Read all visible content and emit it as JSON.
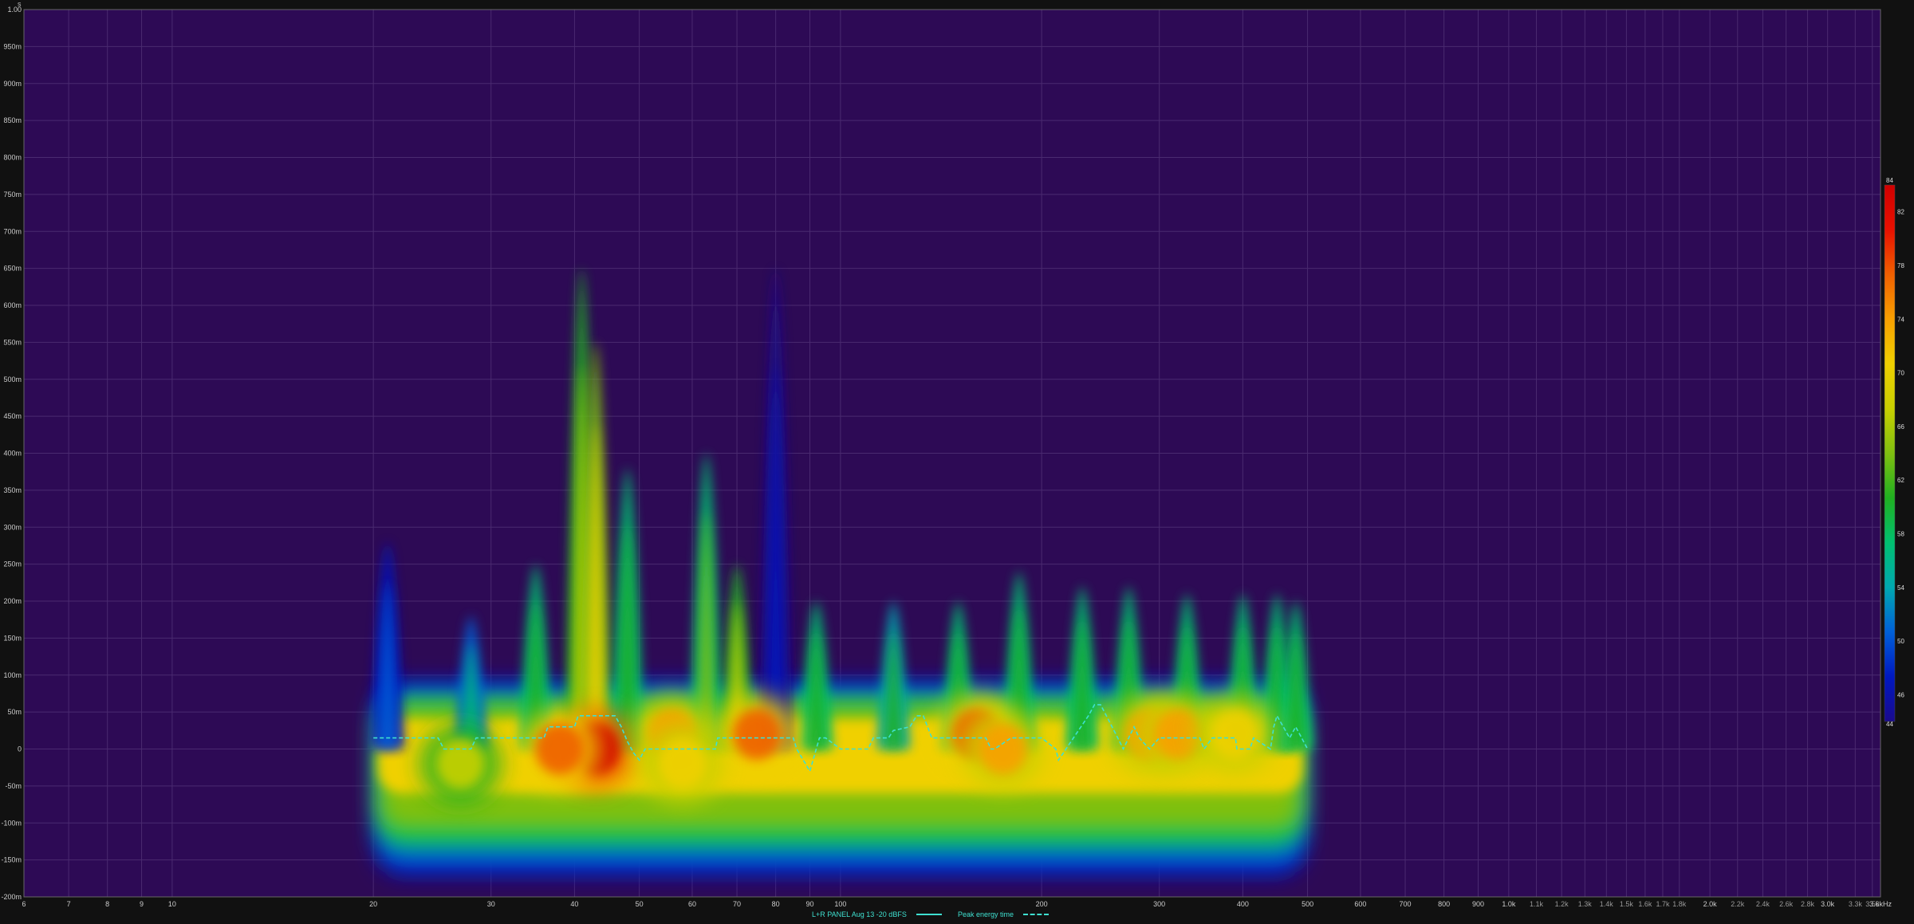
{
  "chart_data": {
    "type": "heatmap",
    "title": "",
    "top_label": "s",
    "xlabel": "",
    "ylabel": "",
    "x_scale": "log",
    "xlim": [
      6,
      3600
    ],
    "ylim": [
      -0.2,
      1.0
    ],
    "x_ticks": [
      {
        "v": 6,
        "t": "6"
      },
      {
        "v": 7,
        "t": "7"
      },
      {
        "v": 8,
        "t": "8"
      },
      {
        "v": 9,
        "t": "9"
      },
      {
        "v": 10,
        "t": "10"
      },
      {
        "v": 20,
        "t": "20"
      },
      {
        "v": 30,
        "t": "30"
      },
      {
        "v": 40,
        "t": "40"
      },
      {
        "v": 50,
        "t": "50"
      },
      {
        "v": 60,
        "t": "60"
      },
      {
        "v": 70,
        "t": "70"
      },
      {
        "v": 80,
        "t": "80"
      },
      {
        "v": 90,
        "t": "90"
      },
      {
        "v": 100,
        "t": "100"
      },
      {
        "v": 200,
        "t": "200"
      },
      {
        "v": 300,
        "t": "300"
      },
      {
        "v": 400,
        "t": "400"
      },
      {
        "v": 500,
        "t": "500"
      },
      {
        "v": 600,
        "t": "600"
      },
      {
        "v": 700,
        "t": "700"
      },
      {
        "v": 800,
        "t": "800"
      },
      {
        "v": 900,
        "t": "900"
      },
      {
        "v": 1000,
        "t": "1.0k"
      },
      {
        "v": 1100,
        "t": "1.1k"
      },
      {
        "v": 1200,
        "t": "1.2k"
      },
      {
        "v": 1300,
        "t": "1.3k"
      },
      {
        "v": 1400,
        "t": "1.4k"
      },
      {
        "v": 1500,
        "t": "1.5k"
      },
      {
        "v": 1600,
        "t": "1.6k"
      },
      {
        "v": 1700,
        "t": "1.7k"
      },
      {
        "v": 1800,
        "t": "1.8k"
      },
      {
        "v": 2000,
        "t": "2.0k"
      },
      {
        "v": 2200,
        "t": "2.2k"
      },
      {
        "v": 2400,
        "t": "2.4k"
      },
      {
        "v": 2600,
        "t": "2.6k"
      },
      {
        "v": 2800,
        "t": "2.8k"
      },
      {
        "v": 3000,
        "t": "3.0k"
      },
      {
        "v": 3300,
        "t": "3.3k"
      },
      {
        "v": 3500,
        "t": "3.5k"
      },
      {
        "v": 3600,
        "t": "3.6kHz"
      }
    ],
    "y_ticks": [
      {
        "v": 1.0,
        "t": "1.00"
      },
      {
        "v": 0.95,
        "t": "950m"
      },
      {
        "v": 0.9,
        "t": "900m"
      },
      {
        "v": 0.85,
        "t": "850m"
      },
      {
        "v": 0.8,
        "t": "800m"
      },
      {
        "v": 0.75,
        "t": "750m"
      },
      {
        "v": 0.7,
        "t": "700m"
      },
      {
        "v": 0.65,
        "t": "650m"
      },
      {
        "v": 0.6,
        "t": "600m"
      },
      {
        "v": 0.55,
        "t": "550m"
      },
      {
        "v": 0.5,
        "t": "500m"
      },
      {
        "v": 0.45,
        "t": "450m"
      },
      {
        "v": 0.4,
        "t": "400m"
      },
      {
        "v": 0.35,
        "t": "350m"
      },
      {
        "v": 0.3,
        "t": "300m"
      },
      {
        "v": 0.25,
        "t": "250m"
      },
      {
        "v": 0.2,
        "t": "200m"
      },
      {
        "v": 0.15,
        "t": "150m"
      },
      {
        "v": 0.1,
        "t": "100m"
      },
      {
        "v": 0.05,
        "t": "50m"
      },
      {
        "v": 0.0,
        "t": "0"
      },
      {
        "v": -0.05,
        "t": "-50m"
      },
      {
        "v": -0.1,
        "t": "-100m"
      },
      {
        "v": -0.15,
        "t": "-150m"
      },
      {
        "v": -0.2,
        "t": "-200m"
      }
    ],
    "colorbar": {
      "min": 44,
      "max": 84,
      "ticks": [
        {
          "v": 84,
          "t": "84"
        },
        {
          "v": 82,
          "t": "82"
        },
        {
          "v": 78,
          "t": "78"
        },
        {
          "v": 74,
          "t": "74"
        },
        {
          "v": 70,
          "t": "70"
        },
        {
          "v": 66,
          "t": "66"
        },
        {
          "v": 62,
          "t": "62"
        },
        {
          "v": 58,
          "t": "58"
        },
        {
          "v": 54,
          "t": "54"
        },
        {
          "v": 50,
          "t": "50"
        },
        {
          "v": 46,
          "t": "46"
        },
        {
          "v": 44,
          "t": "44"
        }
      ],
      "stops": [
        "#1a0a8c",
        "#0018c0",
        "#0060d8",
        "#00a8b0",
        "#00c070",
        "#20b020",
        "#80c010",
        "#c8d000",
        "#f0d000",
        "#f8a000",
        "#f06000",
        "#e81000",
        "#d00000"
      ]
    },
    "background_color": "#2d0a55",
    "data_range": {
      "x": [
        20,
        500
      ]
    },
    "peaks": [
      {
        "f": 21,
        "t": 0.28,
        "lvl": 52
      },
      {
        "f": 28,
        "t": 0.18,
        "lvl": 58
      },
      {
        "f": 35,
        "t": 0.25,
        "lvl": 62
      },
      {
        "f": 41,
        "t": 0.65,
        "lvl": 66
      },
      {
        "f": 43,
        "t": 0.55,
        "lvl": 70
      },
      {
        "f": 48,
        "t": 0.38,
        "lvl": 62
      },
      {
        "f": 63,
        "t": 0.4,
        "lvl": 64
      },
      {
        "f": 70,
        "t": 0.25,
        "lvl": 66
      },
      {
        "f": 80,
        "t": 0.65,
        "lvl": 46
      },
      {
        "f": 92,
        "t": 0.2,
        "lvl": 62
      },
      {
        "f": 120,
        "t": 0.2,
        "lvl": 60
      },
      {
        "f": 150,
        "t": 0.2,
        "lvl": 62
      },
      {
        "f": 185,
        "t": 0.24,
        "lvl": 62
      },
      {
        "f": 230,
        "t": 0.22,
        "lvl": 62
      },
      {
        "f": 270,
        "t": 0.22,
        "lvl": 62
      },
      {
        "f": 330,
        "t": 0.21,
        "lvl": 62
      },
      {
        "f": 400,
        "t": 0.21,
        "lvl": 62
      },
      {
        "f": 450,
        "t": 0.21,
        "lvl": 62
      },
      {
        "f": 480,
        "t": 0.2,
        "lvl": 62
      }
    ],
    "hotspots": [
      {
        "f": 43,
        "t": 0.0,
        "lvl": 84
      },
      {
        "f": 38,
        "t": 0.0,
        "lvl": 78
      },
      {
        "f": 56,
        "t": 0.02,
        "lvl": 74
      },
      {
        "f": 75,
        "t": 0.02,
        "lvl": 76
      },
      {
        "f": 58,
        "t": -0.02,
        "lvl": 72
      },
      {
        "f": 160,
        "t": 0.02,
        "lvl": 76
      },
      {
        "f": 175,
        "t": 0.0,
        "lvl": 74
      },
      {
        "f": 290,
        "t": 0.02,
        "lvl": 74
      },
      {
        "f": 320,
        "t": 0.02,
        "lvl": 74
      },
      {
        "f": 390,
        "t": 0.02,
        "lvl": 72
      },
      {
        "f": 27,
        "t": -0.02,
        "lvl": 68
      }
    ],
    "series": [
      {
        "name": "Peak energy time",
        "x": [
          20,
          25,
          25.5,
          28,
          28.5,
          36,
          36.5,
          40,
          40.5,
          46,
          47,
          48,
          49,
          50,
          51,
          54,
          65,
          65.5,
          85,
          86,
          88,
          90,
          91,
          93,
          95,
          100,
          110,
          112,
          118,
          120,
          127,
          130,
          133,
          135,
          137,
          150,
          165,
          168,
          170,
          180,
          200,
          210,
          212,
          235,
          240,
          245,
          250,
          255,
          260,
          265,
          270,
          275,
          280,
          290,
          300,
          305,
          310,
          345,
          350,
          360,
          390,
          392,
          410,
          415,
          440,
          445,
          450,
          460,
          470,
          480,
          490,
          500
        ],
        "y": [
          0.015,
          0.015,
          0.0,
          0.0,
          0.015,
          0.015,
          0.03,
          0.03,
          0.045,
          0.045,
          0.03,
          0.01,
          -0.005,
          -0.015,
          0.0,
          0.0,
          0.0,
          0.015,
          0.015,
          0.0,
          -0.015,
          -0.03,
          -0.015,
          0.015,
          0.015,
          0.0,
          0.0,
          0.015,
          0.015,
          0.025,
          0.03,
          0.045,
          0.045,
          0.03,
          0.015,
          0.015,
          0.015,
          0.0,
          0.0,
          0.015,
          0.015,
          0.0,
          -0.015,
          0.045,
          0.06,
          0.06,
          0.045,
          0.03,
          0.015,
          0.0,
          0.015,
          0.03,
          0.015,
          0.0,
          0.015,
          0.015,
          0.015,
          0.015,
          0.0,
          0.015,
          0.015,
          0.0,
          0.0,
          0.015,
          0.0,
          0.03,
          0.045,
          0.03,
          0.015,
          0.03,
          0.015,
          0.0
        ]
      }
    ]
  },
  "legend": {
    "items": [
      {
        "label": "L+R PANEL Aug 13 -20 dBFS",
        "style": "solid"
      },
      {
        "label": "Peak energy time",
        "style": "dashed"
      }
    ]
  }
}
